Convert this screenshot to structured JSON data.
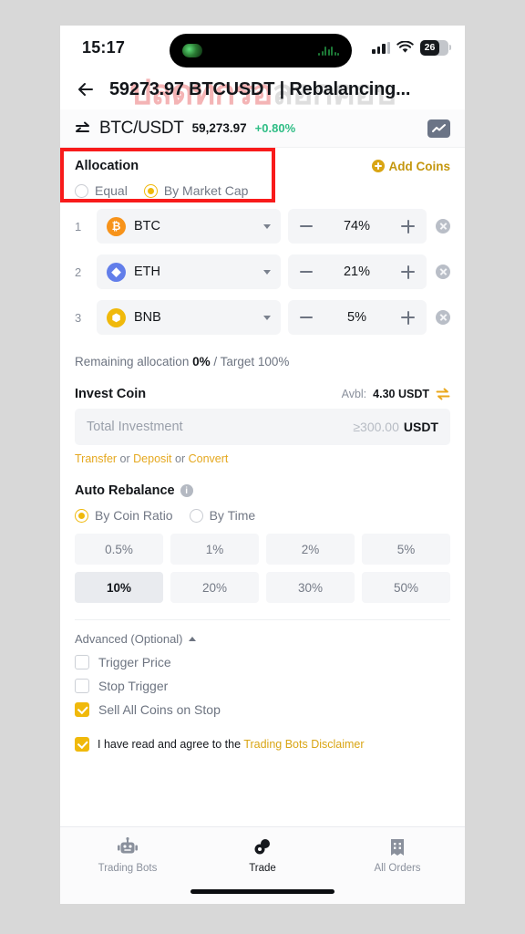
{
  "status_bar": {
    "time": "15:17",
    "battery_level": "26",
    "icons": [
      "signal-icon",
      "wifi-icon",
      "battery-icon"
    ]
  },
  "watermark": {
    "text_pink": "ปลดทกรอ",
    "text_grey": "ลอกคอบ"
  },
  "header": {
    "back_icon": "back-arrow-icon",
    "title": "59273.97 BTCUSDT | Rebalancing..."
  },
  "pair_bar": {
    "swap_icon": "swap-arrows-icon",
    "pair": "BTC/USDT",
    "price": "59,273.97",
    "change": "+0.80%",
    "change_color": "#2ebd85",
    "chart_icon": "line-chart-icon"
  },
  "allocation": {
    "title": "Allocation",
    "add_coins_label": "Add Coins",
    "add_coins_color": "#c4970f",
    "highlight_color": "#f81b1b",
    "options": [
      {
        "label": "Equal",
        "selected": false
      },
      {
        "label": "By Market Cap",
        "selected": true
      }
    ]
  },
  "coins": [
    {
      "index": "1",
      "symbol": "BTC",
      "glyph": "₿",
      "color": "#f7931a",
      "percent": "74%"
    },
    {
      "index": "2",
      "symbol": "ETH",
      "glyph": "◆",
      "color": "#627eea",
      "percent": "21%"
    },
    {
      "index": "3",
      "symbol": "BNB",
      "glyph": "⬢",
      "color": "#f0b90b",
      "percent": "5%"
    }
  ],
  "remaining": {
    "prefix": "Remaining allocation ",
    "value": "0%",
    "suffix": " / Target 100%"
  },
  "invest": {
    "title": "Invest Coin",
    "avbl_label": "Avbl:",
    "avbl_value": "4.30 USDT",
    "swap_icon": "transfer-arrows-icon",
    "placeholder": "Total Investment",
    "min_amount": "≥300.00",
    "unit": "USDT",
    "link_transfer": "Transfer",
    "link_deposit": "Deposit",
    "link_convert": "Convert",
    "link_sep": " or "
  },
  "auto_rebalance": {
    "title": "Auto Rebalance",
    "info_icon": "info-icon",
    "options": [
      {
        "label": "By Coin Ratio",
        "selected": true
      },
      {
        "label": "By Time",
        "selected": false
      }
    ],
    "thresholds": [
      {
        "label": "0.5%",
        "selected": false
      },
      {
        "label": "1%",
        "selected": false
      },
      {
        "label": "2%",
        "selected": false
      },
      {
        "label": "5%",
        "selected": false
      },
      {
        "label": "10%",
        "selected": true
      },
      {
        "label": "20%",
        "selected": false
      },
      {
        "label": "30%",
        "selected": false
      },
      {
        "label": "50%",
        "selected": false
      }
    ]
  },
  "advanced": {
    "title": "Advanced (Optional)",
    "chevron": "chevron-up-icon",
    "checkboxes": [
      {
        "label": "Trigger Price",
        "checked": false
      },
      {
        "label": "Stop Trigger",
        "checked": false
      },
      {
        "label": "Sell All Coins on Stop",
        "checked": true
      }
    ]
  },
  "agreement": {
    "checked": true,
    "text": "I have read and agree to the ",
    "link": "Trading Bots Disclaimer"
  },
  "bottom_nav": [
    {
      "label": "Trading Bots",
      "icon": "robot-icon",
      "active": false
    },
    {
      "label": "Trade",
      "icon": "coins-icon",
      "active": true
    },
    {
      "label": "All Orders",
      "icon": "orders-icon",
      "active": false
    }
  ]
}
